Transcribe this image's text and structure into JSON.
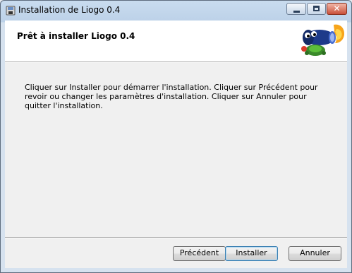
{
  "window": {
    "title": "Installation de Liogo 0.4",
    "minimize_icon": "minimize-icon",
    "maximize_icon": "maximize-icon",
    "close_glyph": "✕"
  },
  "banner": {
    "heading": "Prêt à installer Liogo 0.4",
    "logo": "liogo-logo"
  },
  "body": {
    "message": "Cliquer sur Installer pour démarrer l'installation. Cliquer sur Précédent pour revoir ou changer les paramètres d'installation. Cliquer sur Annuler pour quitter l'installation."
  },
  "buttons": {
    "back": "Précédent",
    "install": "Installer",
    "cancel": "Annuler"
  }
}
